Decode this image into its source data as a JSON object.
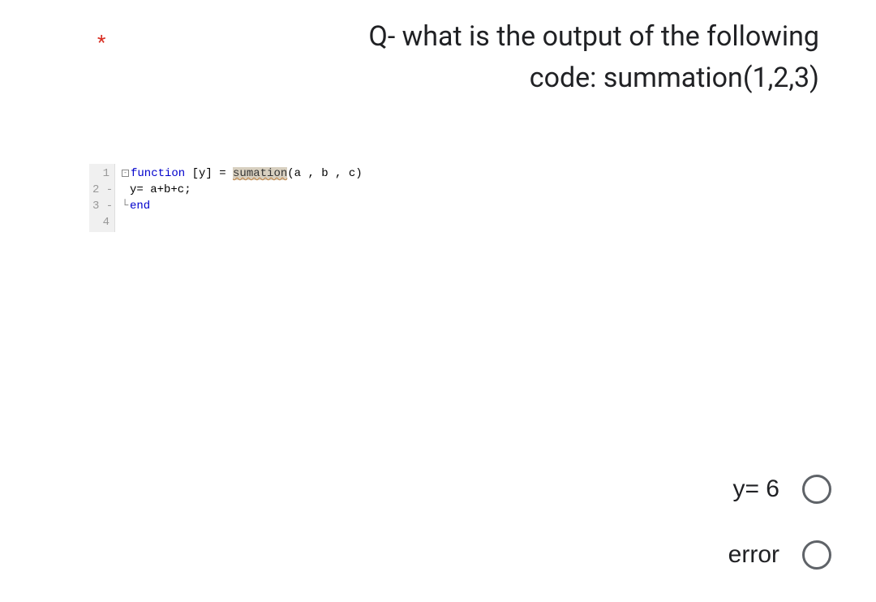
{
  "required_marker": "*",
  "question_line1": "Q- what is the output of the following",
  "question_line2": "code: summation(1,2,3)",
  "gutter": {
    "l1": "1",
    "l2": "2 -",
    "l3": "3 -",
    "l4": "4"
  },
  "code": {
    "l1_kw": "function",
    "l1_mid": " [y] = ",
    "l1_fn": "sumation",
    "l1_rest": "(a , b , c)",
    "l2": "y= a+b+c;",
    "l3": "end",
    "l4": ""
  },
  "options": {
    "a": "y= 6",
    "b": "error"
  }
}
